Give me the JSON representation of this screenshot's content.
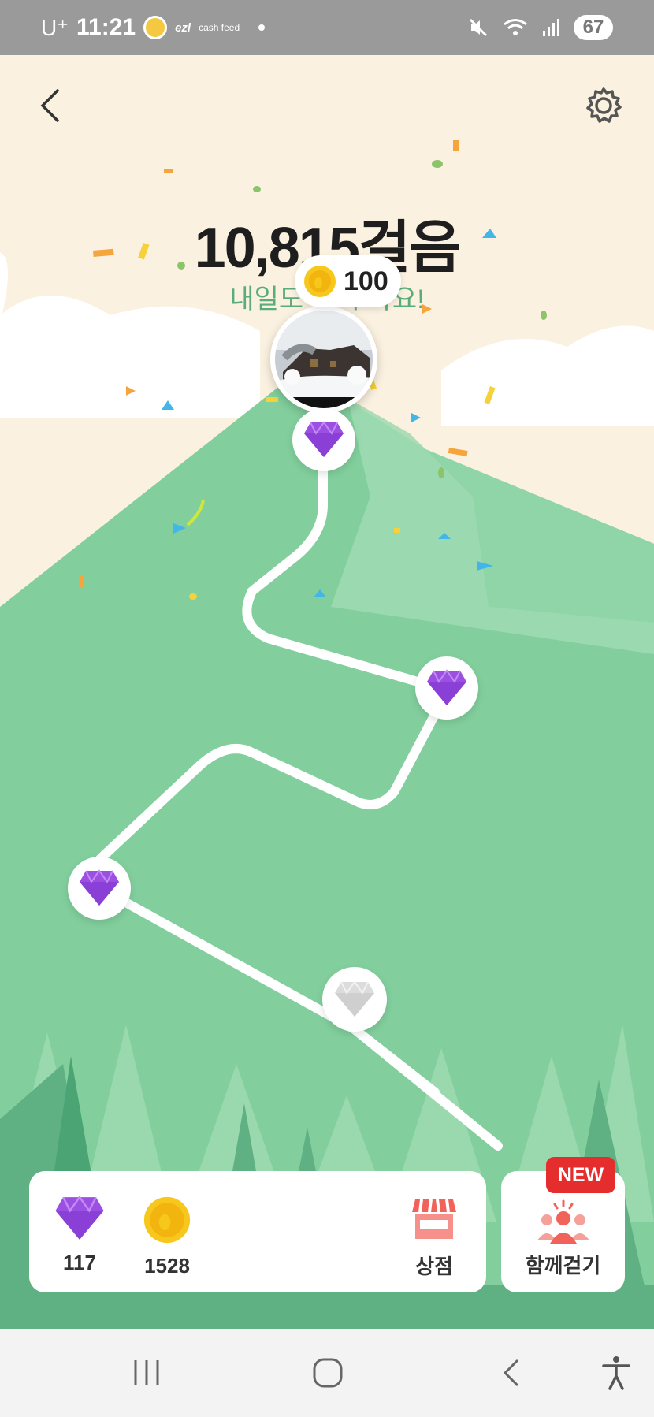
{
  "status_bar": {
    "carrier": "U⁺",
    "time": "11:21",
    "app_icons": [
      "sun-icon",
      "ezl",
      "cash feed"
    ],
    "app_label_1": "ezl",
    "app_label_2": "cash feed",
    "battery": "67"
  },
  "header": {
    "back_icon": "chevron-left-icon",
    "settings_icon": "gear-icon"
  },
  "steps": {
    "count_text": "10,815걸음",
    "message": "내일도 다시 봐요!"
  },
  "reward_bubble": {
    "coin_value": "100"
  },
  "bottom_panel": {
    "gems_count": "117",
    "coins_count": "1528",
    "store_label": "상점"
  },
  "walk_together": {
    "label": "함께걷기",
    "badge": "NEW"
  },
  "colors": {
    "sky": "#fbf1e0",
    "mountain": "#82cf9d",
    "gem_purple": "#9b4fe3",
    "badge_red": "#e52d2d"
  }
}
